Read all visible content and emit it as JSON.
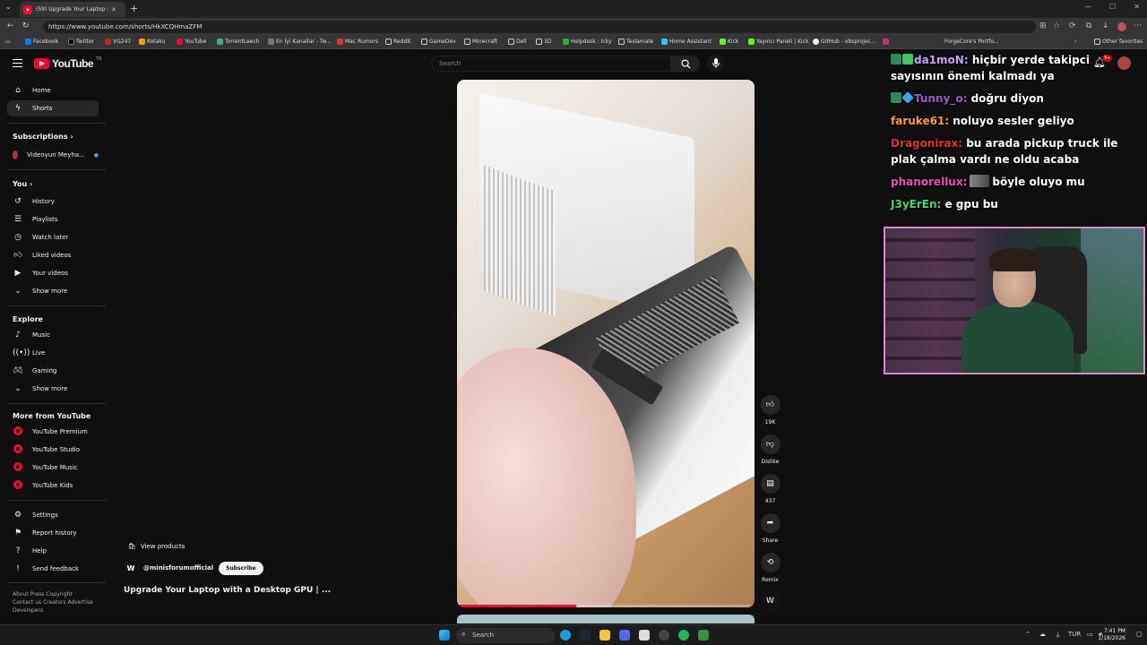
{
  "browser": {
    "tab_title": "(59) Upgrade Your Laptop with a",
    "url": "https://www.youtube.com/shorts/HkXCQHmaZFM",
    "bookmarks": [
      "Facebook",
      "Twitter",
      "VG247",
      "Kotaku",
      "YouTube",
      "TorrentLeech",
      "En İyi Kanallar - Tw...",
      "Mac Rumors",
      "Reddit",
      "GameDev",
      "Minecraft",
      "Dell",
      "3D",
      "Helpdesk : Icky",
      "Teslamate",
      "Home Assistant",
      "Kick",
      "Yayıncı Paneli | Kick",
      "GitHub - obsprojec...",
      "ForgeCore's Portfo..."
    ],
    "other_favorites": "Other favorites"
  },
  "youtube": {
    "logo": "YouTube",
    "region": "TR",
    "search_placeholder": "Search",
    "nav": {
      "home": "Home",
      "shorts": "Shorts",
      "subscriptions": "Subscriptions",
      "sub_channel": "Videoyun Meyha...",
      "you": "You",
      "history": "History",
      "playlists": "Playlists",
      "watch_later": "Watch later",
      "liked": "Liked videos",
      "your_videos": "Your videos",
      "show_more_1": "Show more",
      "explore": "Explore",
      "music": "Music",
      "live": "Live",
      "gaming": "Gaming",
      "show_more_2": "Show more",
      "more_from": "More from YouTube",
      "premium": "YouTube Premium",
      "studio": "YouTube Studio",
      "yt_music": "YouTube Music",
      "kids": "YouTube Kids",
      "settings": "Settings",
      "report": "Report history",
      "help": "Help",
      "feedback": "Send feedback"
    },
    "footer_line1": "About  Press  Copyright",
    "footer_line2": "Contact us  Creators  Advertise",
    "footer_line3": "Developers",
    "notif_count": "9+",
    "short": {
      "view_products": "View products",
      "channel": "@minisforumofficial",
      "subscribe": "Subscribe",
      "title": "Upgrade Your Laptop with a Desktop GPU | ...",
      "likes": "19K",
      "dislike": "Dislike",
      "comments": "437",
      "share": "Share",
      "remix": "Remix",
      "progress": 0.4
    }
  },
  "chat": [
    {
      "user": "da1moN:",
      "color": "#c4a3ff",
      "text": "hiçbir yerde takipci sayısının önemi kalmadı ya"
    },
    {
      "user": "Tunny_o:",
      "color": "#9b59d0",
      "text": "doğru diyon"
    },
    {
      "user": "faruke61:",
      "color": "#ff9e2c",
      "text": "noluyo sesler geliyo"
    },
    {
      "user": "Dragonirax:",
      "color": "#e0303a",
      "text": "bu arada pickup truck ile plak çalma vardı ne oldu acaba"
    },
    {
      "user": "phanorellux:",
      "color": "#e64fb3",
      "text": "böyle oluyo mu"
    },
    {
      "user": "J3yErEn:",
      "color": "#48d95a",
      "text": "e gpu bu"
    }
  ],
  "taskbar": {
    "search": "Search",
    "lang": "TUR",
    "time": "7:41 PM",
    "date": "1/18/2026"
  }
}
